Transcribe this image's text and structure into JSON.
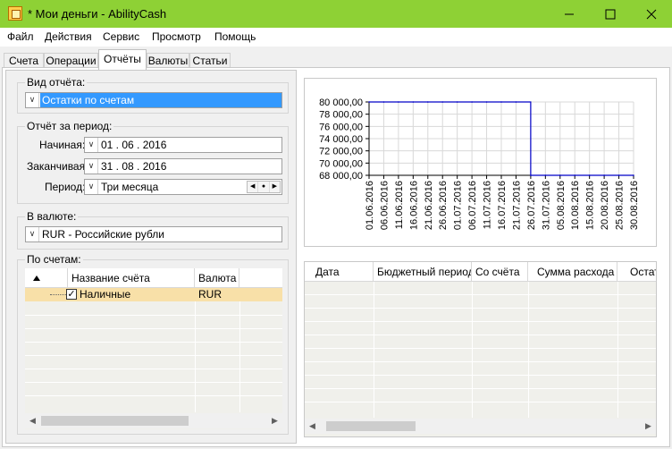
{
  "window": {
    "title": "* Мои деньги - AbilityCash"
  },
  "menu": [
    "Файл",
    "Действия",
    "Сервис",
    "Просмотр",
    "Помощь"
  ],
  "tabs": [
    "Счета",
    "Операции",
    "Отчёты",
    "Валюты",
    "Статьи"
  ],
  "active_tab": "Отчёты",
  "report_type": {
    "label": "Вид отчёта:",
    "value": "Остатки по счетам"
  },
  "period_group": {
    "label": "Отчёт за период:",
    "start_label": "Начиная:",
    "start_value": "01 . 06 . 2016",
    "end_label": "Заканчивая:",
    "end_value": "31 . 08 . 2016",
    "period_label": "Период:",
    "period_value": "Три месяца"
  },
  "currency_group": {
    "label": "В валюте:",
    "value": "RUR - Российские рубли"
  },
  "accounts_group": {
    "label": "По счетам:",
    "columns": [
      "Название счёта",
      "Валюта"
    ],
    "rows": [
      {
        "name": "Наличные",
        "currency": "RUR",
        "checked": true
      }
    ]
  },
  "results_table": {
    "columns": [
      "Дата",
      "Бюджетный период",
      "Со счёта",
      "Сумма расхода",
      "Остат"
    ]
  },
  "chart_data": {
    "type": "line",
    "ylim": [
      68000,
      80000
    ],
    "yticks": [
      "68 000,00",
      "70 000,00",
      "72 000,00",
      "74 000,00",
      "76 000,00",
      "78 000,00",
      "80 000,00"
    ],
    "x": [
      "01.06.2016",
      "06.06.2016",
      "11.06.2016",
      "16.06.2016",
      "21.06.2016",
      "26.06.2016",
      "01.07.2016",
      "06.07.2016",
      "11.07.2016",
      "16.07.2016",
      "21.07.2016",
      "26.07.2016",
      "31.07.2016",
      "05.08.2016",
      "10.08.2016",
      "15.08.2016",
      "20.08.2016",
      "25.08.2016",
      "30.08.2016"
    ],
    "series": [
      {
        "values": [
          80000,
          80000,
          80000,
          80000,
          80000,
          80000,
          80000,
          80000,
          80000,
          80000,
          80000,
          68000,
          68000,
          68000,
          68000,
          68000,
          68000,
          68000,
          68000
        ]
      }
    ],
    "grid": true,
    "colors": {
      "line": "#0000c8",
      "grid": "#d8d8d8"
    }
  }
}
